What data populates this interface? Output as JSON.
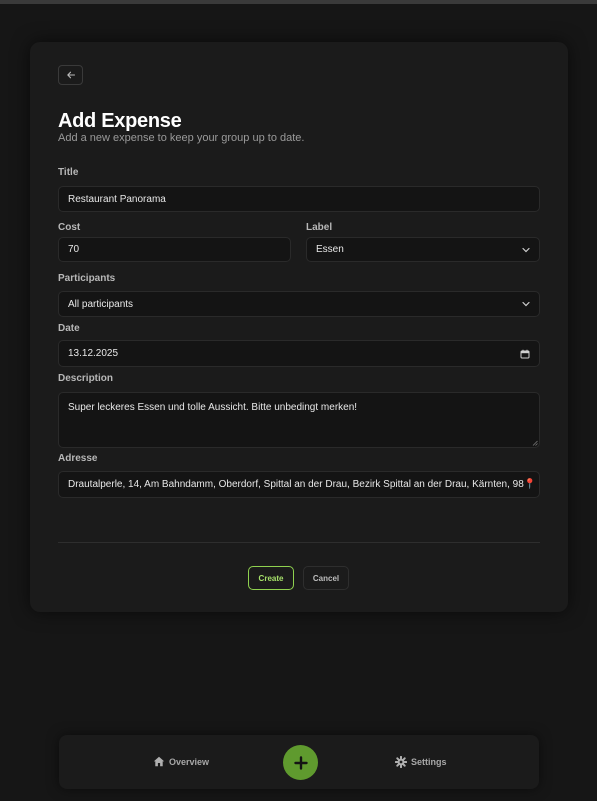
{
  "form": {
    "title": "Add Expense",
    "subtitle": "Add a new expense to keep your group up to date.",
    "title_label": "Title",
    "title_value": "Restaurant Panorama",
    "cost_label": "Cost",
    "cost_value": "70",
    "label_label": "Label",
    "label_value": "Essen",
    "participants_label": "Participants",
    "participants_value": "All participants",
    "date_label": "Date",
    "date_value": "13.12.2025",
    "description_label": "Description",
    "description_value": "Super leckeres Essen und tolle Aussicht. Bitte unbedingt merken!",
    "address_label": "Adresse",
    "address_value": "Drautalperle, 14, Am Bahndamm, Oberdorf, Spittal an der Drau, Bezirk Spittal an der Drau, Kärnten, 98📍"
  },
  "actions": {
    "create_label": "Create",
    "cancel_label": "Cancel"
  },
  "nav": {
    "overview_label": "Overview",
    "settings_label": "Settings",
    "fab_icon": "plus-icon"
  },
  "colors": {
    "accent": "#8fd14f",
    "fab": "#5f9a2e",
    "background": "#161616",
    "card": "#1b1b1b"
  }
}
